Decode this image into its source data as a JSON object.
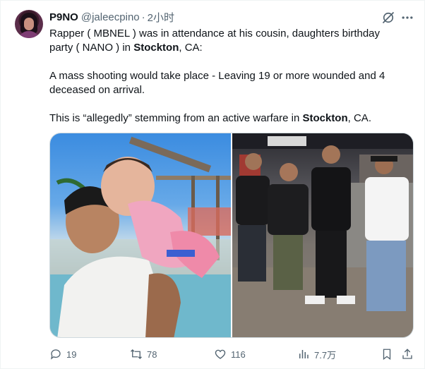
{
  "author": {
    "name": "P9NO",
    "handle": "@jaleecpino",
    "separator": "·",
    "time": "2小时"
  },
  "body": {
    "p1_a": "Rapper ( MBNEL ) was in attendance at his cousin, daughters birthday party ( NANO ) in ",
    "p1_bold": "Stockton",
    "p1_b": ", CA:",
    "p2": "A mass shooting would take place - Leaving 19 or more wounded and 4 deceased on arrival.",
    "p3_a": "This is “allegedly” stemming from an active warfare in ",
    "p3_bold": "Stockton",
    "p3_b": ", CA."
  },
  "actions": {
    "replies": "19",
    "reposts": "78",
    "likes": "116",
    "views": "7.7万"
  },
  "icons": {
    "top_right": [
      "grok-icon",
      "more-icon"
    ],
    "actions": [
      "reply-icon",
      "repost-icon",
      "like-icon",
      "views-icon",
      "bookmark-icon",
      "share-icon"
    ]
  },
  "colors": {
    "text": "#0f1419",
    "secondary": "#536471",
    "border": "#cfd9de"
  }
}
